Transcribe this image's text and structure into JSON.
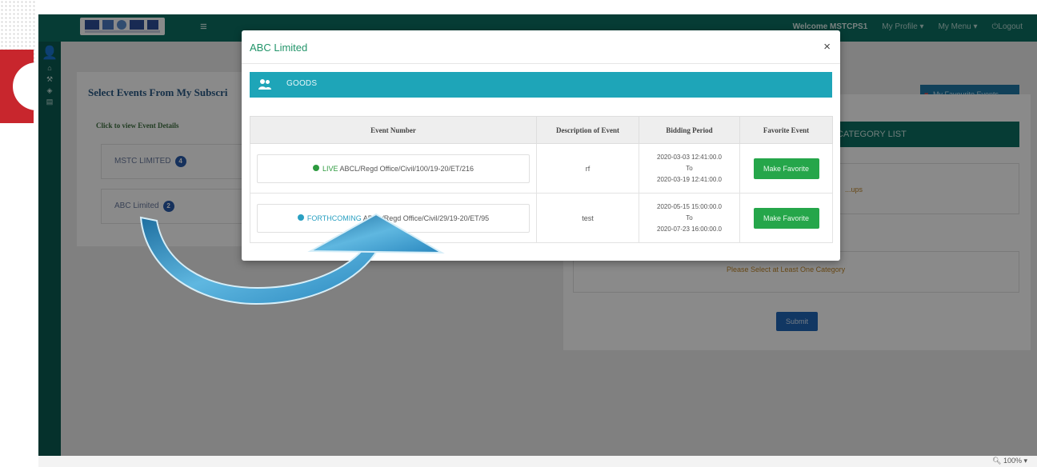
{
  "header": {
    "nav": [
      "Welcome MSTCPS1",
      "My Profile ▾",
      "My Menu ▾",
      "Logout"
    ]
  },
  "left_panel": {
    "title": "Select Events From My Subscri",
    "subtitle": "Click to view Event Details",
    "items": [
      {
        "label": "MSTC LIMITED",
        "count": "4"
      },
      {
        "label": "ABC Limited",
        "count": "2"
      }
    ]
  },
  "right_panel": {
    "fav_button": "My Favourite Events",
    "category_header": "CATEGORY LIST",
    "warning_top": "...ups",
    "warning_bottom": "Please Select at Least One Category",
    "submit": "Submit"
  },
  "modal": {
    "title": "ABC Limited",
    "section": "GOODS",
    "columns": [
      "Event Number",
      "Description of Event",
      "Bidding Period",
      "Favorite Event"
    ],
    "rows": [
      {
        "status": "LIVE",
        "status_color": "#2d9a3f",
        "event_number": "ABCL/Regd Office/Civil/100/19-20/ET/216",
        "description": "rf",
        "period_from": "2020-03-03 12:41:00.0",
        "period_to_word": "To",
        "period_to": "2020-03-19 12:41:00.0",
        "action": "Make Favorite"
      },
      {
        "status": "FORTHCOMING",
        "status_color": "#2aa0c2",
        "event_number": "ABCL/Regd Office/Civil/29/19-20/ET/95",
        "description": "test",
        "period_from": "2020-05-15 15:00:00.0",
        "period_to_word": "To",
        "period_to": "2020-07-23 16:00:00.0",
        "action": "Make Favorite"
      }
    ]
  },
  "statusbar": {
    "zoom": "100%"
  },
  "colors": {
    "topbar": "#0c6f63",
    "modal_title": "#23956a",
    "goods_bar": "#1ea5b8",
    "make_favorite": "#25a64a"
  }
}
